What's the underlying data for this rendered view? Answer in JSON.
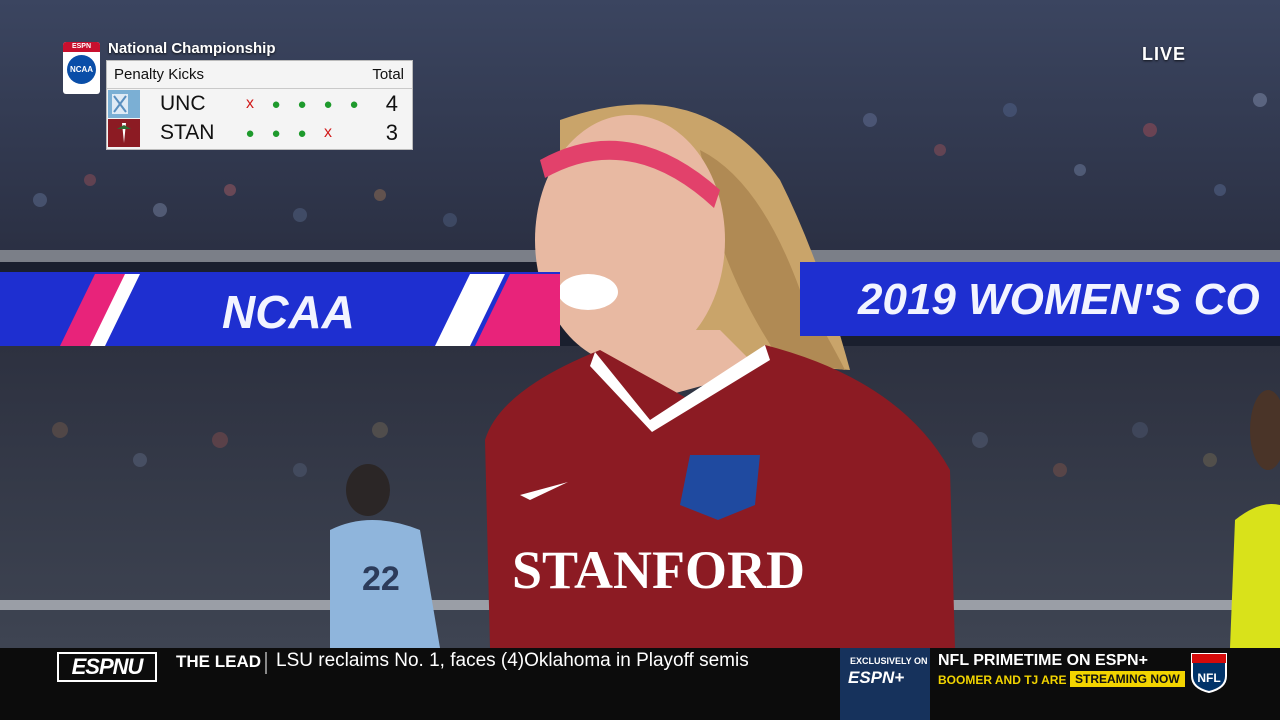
{
  "scorebug": {
    "network_tag": "ESPN",
    "event_logo": "NCAA",
    "title": "National Championship",
    "header_label": "Penalty Kicks",
    "header_total": "Total",
    "teams": [
      {
        "name": "UNC",
        "kicks": [
          "x",
          "●",
          "●",
          "●",
          "●"
        ],
        "total": "4"
      },
      {
        "name": "STAN",
        "kicks": [
          "●",
          "●",
          "●",
          "x"
        ],
        "total": "3"
      }
    ]
  },
  "live_label": "LIVE",
  "ribbon": {
    "left_text": "NCAA",
    "right_text": "2019 WOMEN'S CO"
  },
  "jersey": {
    "text": "STANFORD",
    "opponent_number": "22"
  },
  "ticker": {
    "channel": "ESPNU",
    "section": "THE LEAD",
    "headline": "LSU reclaims No. 1, faces (4)Oklahoma in Playoff semis",
    "promo_small": "EXCLUSIVELY ON",
    "promo_brand": "ESPN+",
    "nfl_title": "NFL PRIMETIME ON ESPN+",
    "nfl_sub": "BOOMER AND TJ ARE BACK",
    "nfl_badge": "STREAMING NOW",
    "nfl_logo": "NFL"
  },
  "colors": {
    "stanford_cardinal": "#8c1b23",
    "unc_blue": "#7bafd4",
    "made_kick": "#1e9a2c",
    "missed_kick": "#d11a1a",
    "ribbon_blue": "#1e2fd0",
    "ribbon_pink": "#e8237a",
    "ticker_yellow": "#f2d400"
  }
}
